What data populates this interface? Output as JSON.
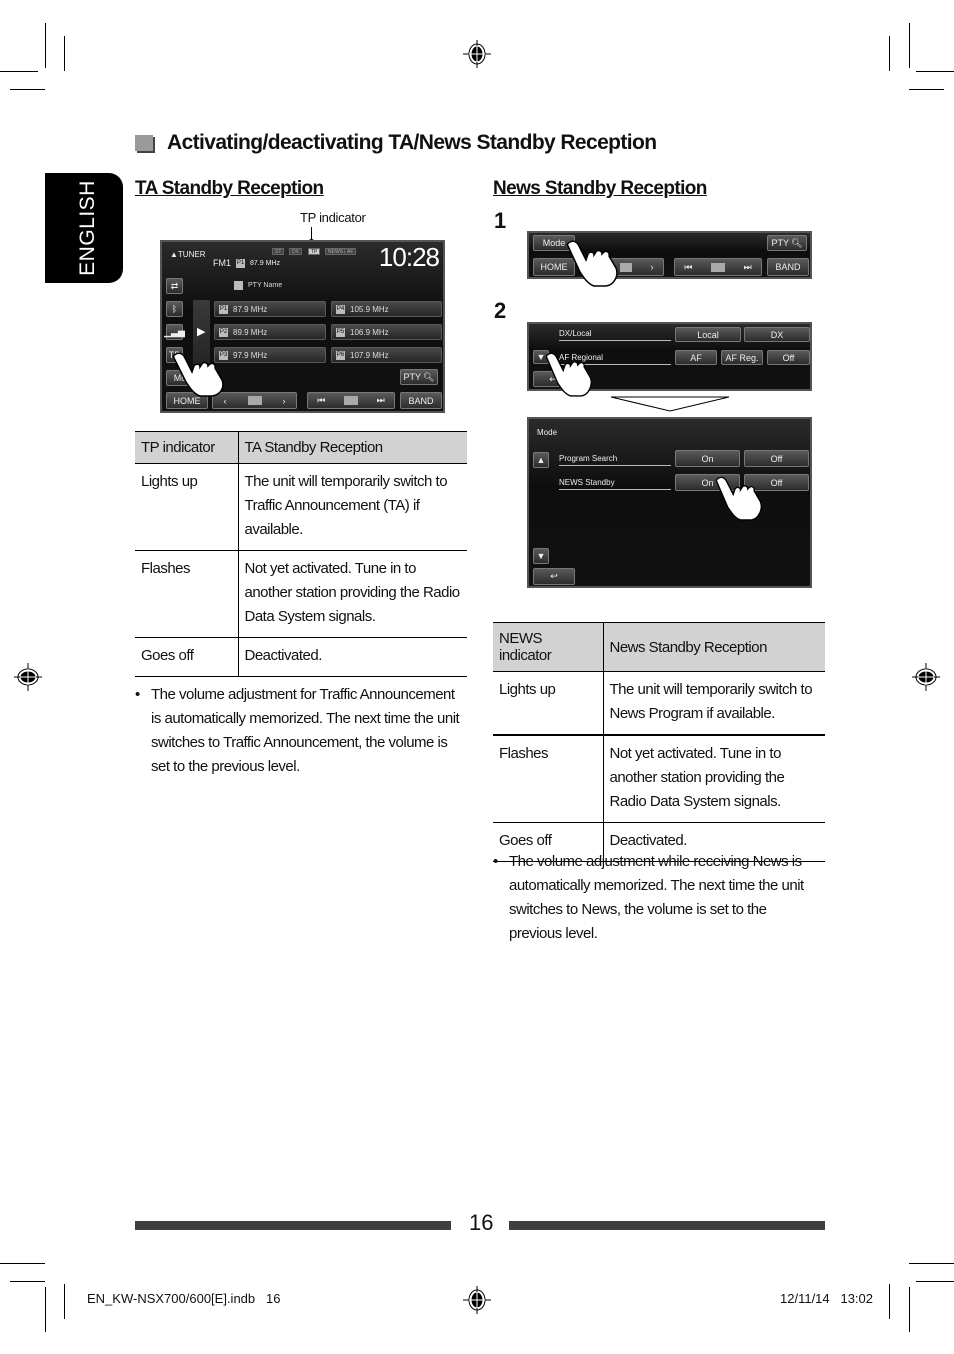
{
  "section_title": "Activating/deactivating TA/News Standby Reception",
  "language_tab": "ENGLISH",
  "ta": {
    "title": "TA Standby Reception",
    "tp_callout": "TP indicator",
    "screen": {
      "source": "TUNER",
      "band": "FM1",
      "preset_badge": "P1",
      "frequency": "87.9 MHz",
      "pty_name": "PTY Name",
      "clock": "10:28",
      "indicators": [
        "ST",
        "DX",
        "TP",
        "NEWS",
        "AF"
      ],
      "presets": [
        {
          "badge": "P1",
          "freq": "87.9 MHz"
        },
        {
          "badge": "P4",
          "freq": "105.9 MHz"
        },
        {
          "badge": "P2",
          "freq": "89.9 MHz"
        },
        {
          "badge": "P5",
          "freq": "106.9 MHz"
        },
        {
          "badge": "P3",
          "freq": "97.9 MHz"
        },
        {
          "badge": "P6",
          "freq": "107.9 MHz"
        }
      ],
      "tp_button": "TP",
      "mode_button": "Mo",
      "pty_button": "PTY",
      "home_button": "HOME",
      "band_button": "BAND"
    },
    "table": {
      "headers": [
        "TP indicator",
        "TA Standby Reception"
      ],
      "rows": [
        [
          "Lights up",
          "The unit will temporarily switch to Traffic Announcement (TA) if available."
        ],
        [
          "Flashes",
          "Not yet activated. Tune in to another station providing the Radio Data System signals."
        ],
        [
          "Goes off",
          "Deactivated."
        ]
      ]
    },
    "note": "The volume adjustment for Traffic Announcement is automatically memorized. The next time the unit switches to Traffic Announcement, the volume is set to the previous level."
  },
  "news": {
    "title": "News Standby Reception",
    "step1": {
      "number": "1",
      "mode_button": "Mode",
      "pty_button": "PTY",
      "home_button": "HOME",
      "band_button": "BAND"
    },
    "step2": {
      "number": "2",
      "screen_a": {
        "rows": [
          {
            "label": "DX/Local",
            "options": [
              "Local",
              "DX"
            ]
          },
          {
            "label": "AF Regional",
            "options": [
              "AF",
              "AF Reg.",
              "Off"
            ]
          }
        ]
      },
      "screen_b": {
        "title": "Mode",
        "rows": [
          {
            "label": "Program Search",
            "options": [
              "On",
              "Off"
            ]
          },
          {
            "label": "NEWS Standby",
            "options": [
              "On",
              "Off"
            ]
          }
        ]
      }
    },
    "table": {
      "headers": [
        "NEWS indicator",
        "News Standby Reception"
      ],
      "rows": [
        [
          "Lights up",
          "The unit will temporarily switch to News Program if available."
        ],
        [
          "Flashes",
          "Not yet activated. Tune in to another station providing the Radio Data System signals."
        ],
        [
          "Goes off",
          "Deactivated."
        ]
      ]
    },
    "note": "The volume adjustment while receiving News is automatically memorized. The next time the unit switches to News, the volume is set to the previous level."
  },
  "page_number": "16",
  "footer": {
    "file": "EN_KW-NSX700/600[E].indb   16",
    "datetime": "12/11/14   13:02"
  }
}
